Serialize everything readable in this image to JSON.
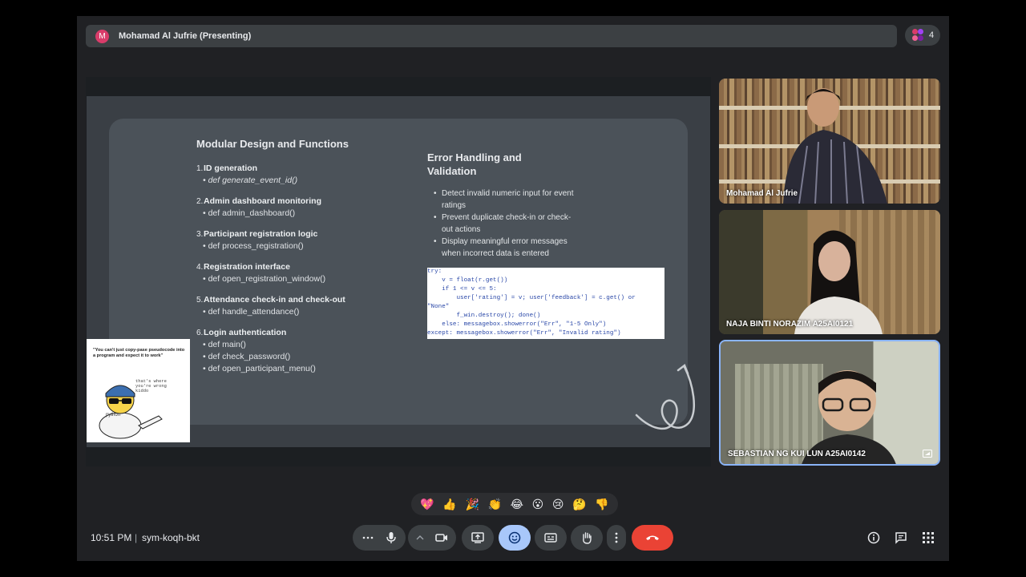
{
  "presenting": {
    "avatar_letter": "M",
    "text": "Mohamad Al Jufrie (Presenting)"
  },
  "participants": {
    "count": "4"
  },
  "slide": {
    "left_title": "Modular Design and Functions",
    "items": [
      {
        "num": "1.",
        "title": "ID generation",
        "sub": "def generate_event_id()",
        "italic": true
      },
      {
        "num": "2.",
        "title": "Admin dashboard monitoring",
        "sub": "def admin_dashboard()",
        "italic": false
      },
      {
        "num": "3.",
        "title": "Participant registration logic",
        "sub": "def process_registration()",
        "italic": false
      },
      {
        "num": "4.",
        "title": "Registration interface",
        "sub": "def open_registration_window()",
        "italic": false
      },
      {
        "num": "5.",
        "title": "Attendance check-in and check-out",
        "sub": "def handle_attendance()",
        "italic": false
      },
      {
        "num": "6.",
        "title": "Login authentication",
        "subs": [
          "def main()",
          "def check_password()",
          "def open_participant_menu()"
        ]
      }
    ],
    "right_title_1": "Error Handling and",
    "right_title_2": "Validation",
    "bullets": [
      "Detect invalid numeric input for event ratings",
      "Prevent duplicate check-in or check-out actions",
      "Display meaningful error messages when incorrect data is entered"
    ],
    "code_lines": [
      "try:",
      "    v = float(r.get())",
      "    if 1 <= v <= 5:",
      "        user['rating'] = v; user['feedback'] = c.get() or",
      "\"None\"",
      "        f_win.destroy(); done()",
      "    else: messagebox.showerror(\"Err\", \"1-5 Only\")",
      "except: messagebox.showerror(\"Err\", \"Invalid rating\")"
    ]
  },
  "meme": {
    "caption": "\"You can't just copy-pase pseudocode into a program and expect it to work\"",
    "reply_1": "that's where",
    "reply_2": "you're wrong",
    "reply_3": "kiddo",
    "hat_text": "python"
  },
  "tiles": [
    {
      "name": "Mohamad Al Jufrie"
    },
    {
      "name": "NAJA BINTI NORAZIM A25AI0121"
    },
    {
      "name": "SEBASTIAN NG KUI LUN A25AI0142"
    }
  ],
  "reactions": [
    "💖",
    "👍",
    "🎉",
    "👏",
    "😂",
    "😮",
    "😢",
    "🤔",
    "👎"
  ],
  "bottom": {
    "time": "10:51 PM",
    "separator": "|",
    "meeting_code": "sym-koqh-bkt"
  },
  "colors": {
    "end_call": "#ea4335",
    "active_control": "#a8c7fa",
    "bar": "#3c4043",
    "background": "#202124"
  }
}
